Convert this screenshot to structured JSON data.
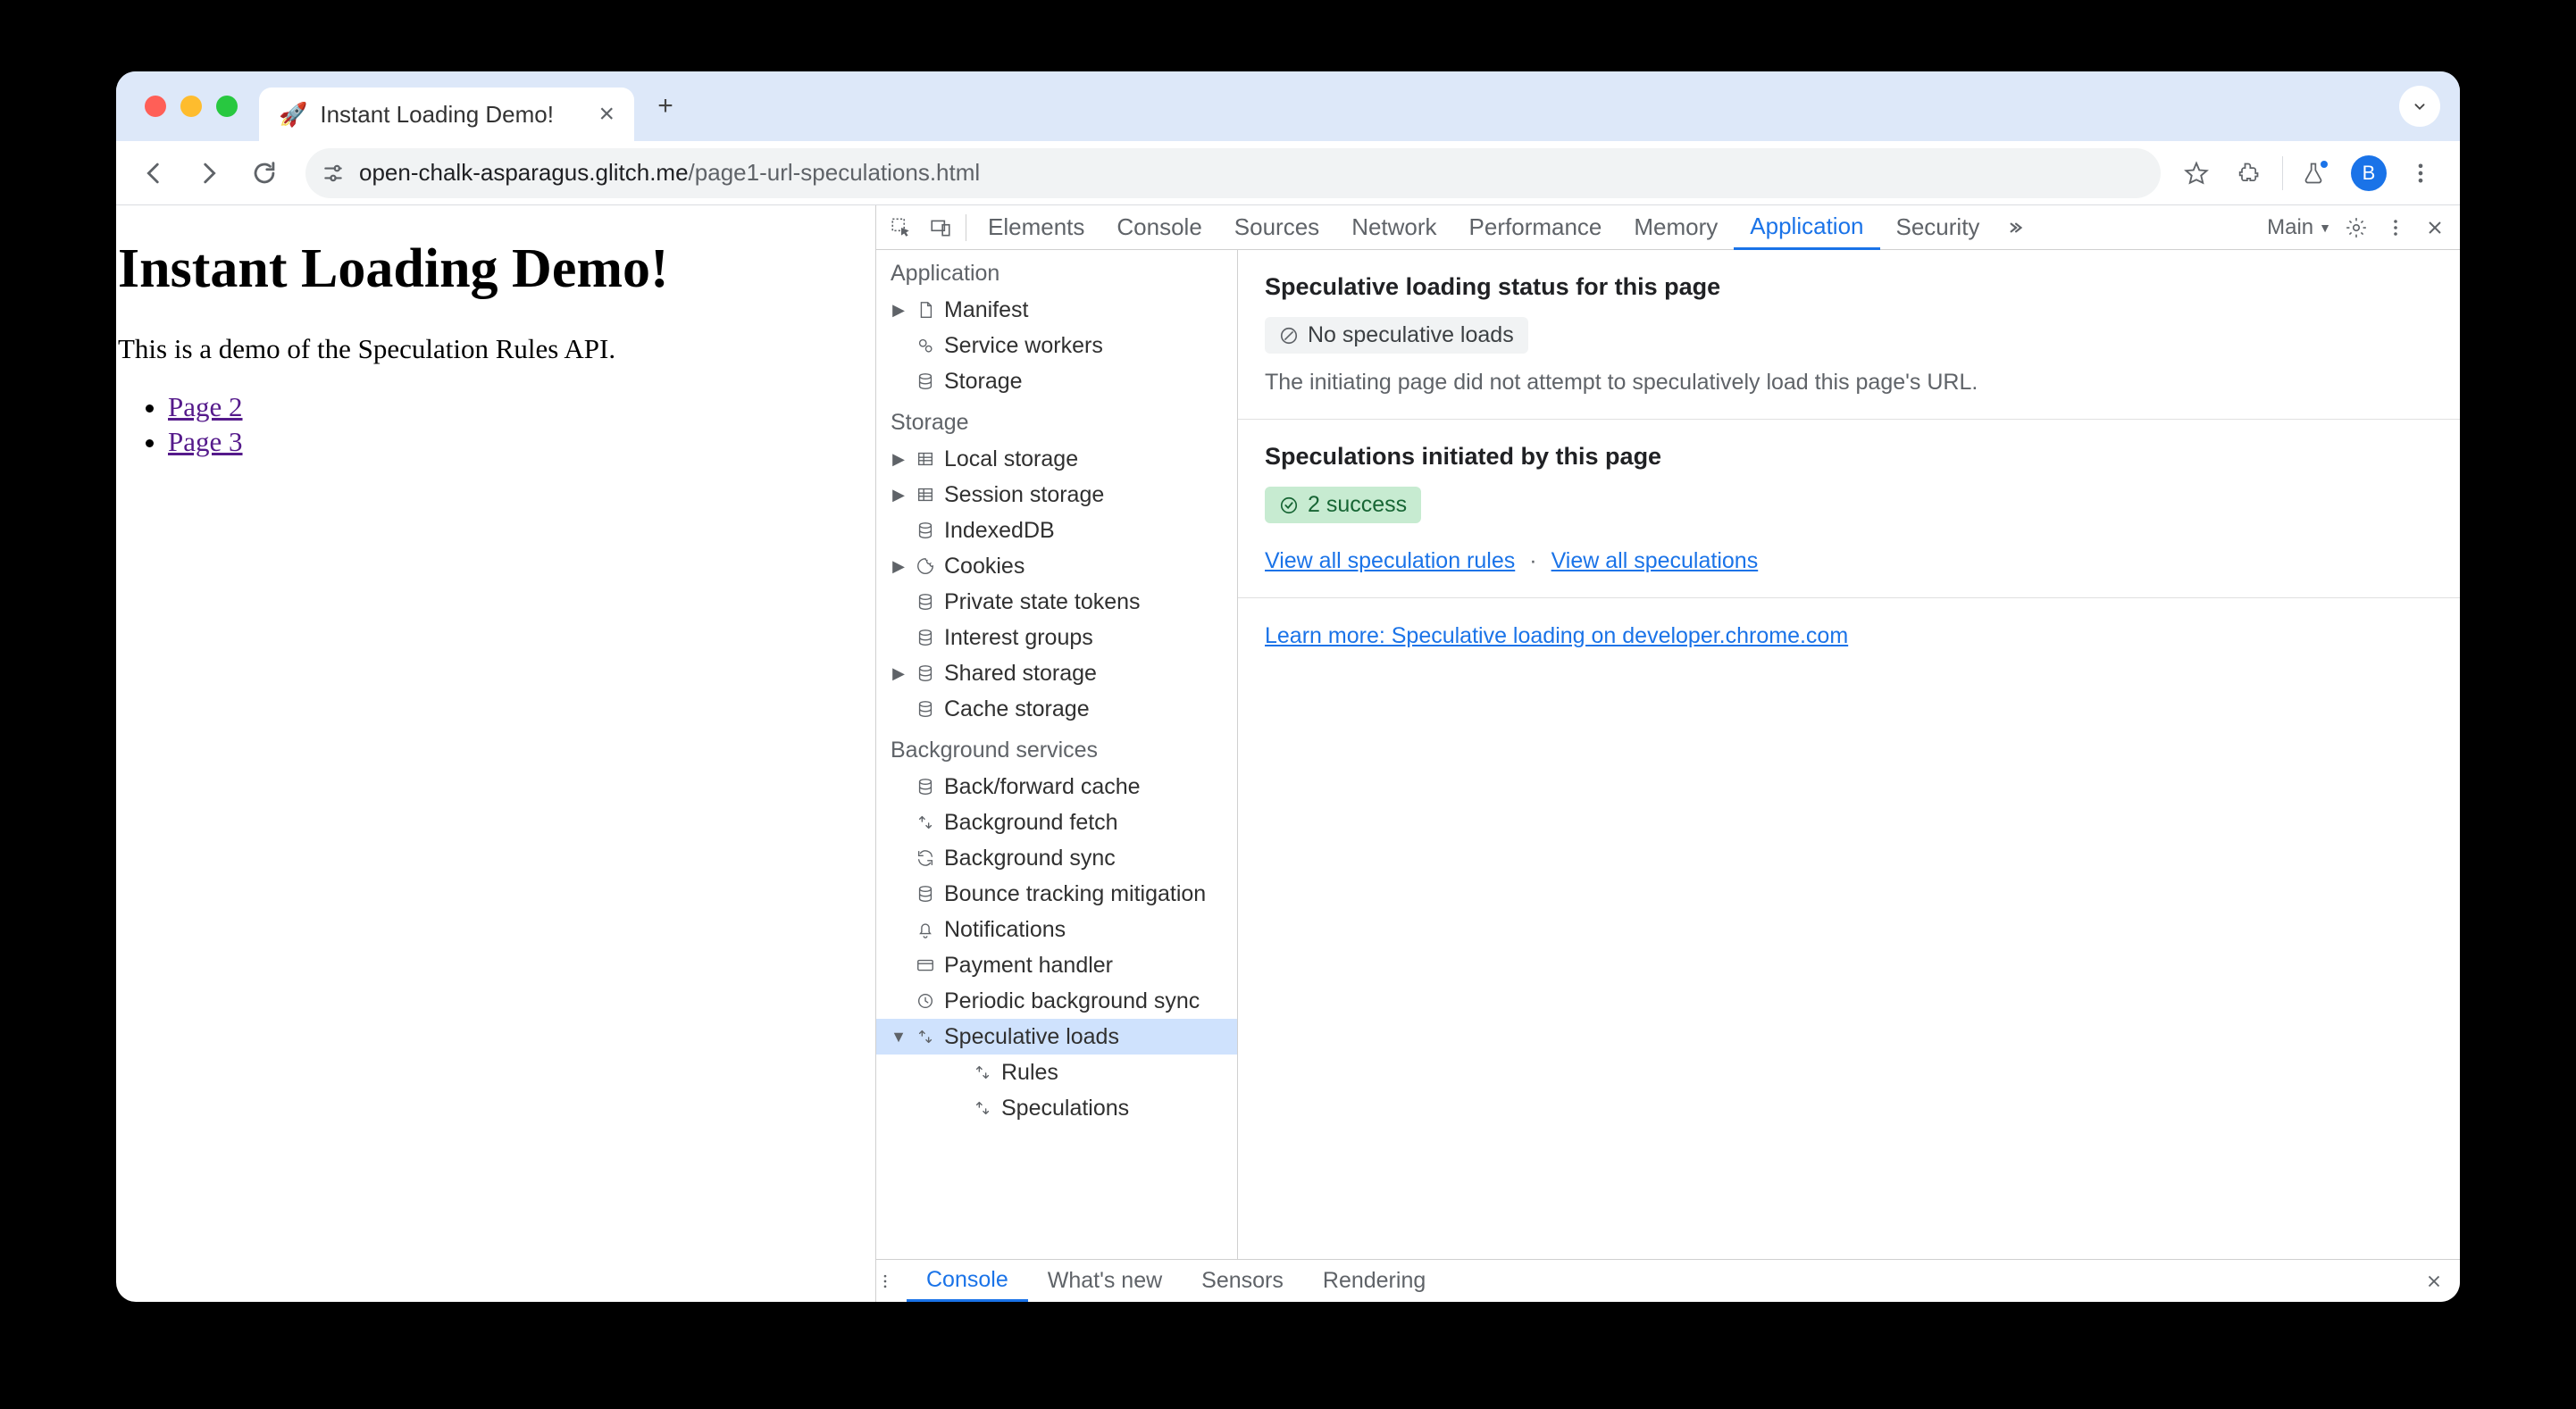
{
  "browser": {
    "tab_title": "Instant Loading Demo!",
    "tab_favicon": "🚀",
    "url_host": "open-chalk-asparagus.glitch.me",
    "url_path": "/page1-url-speculations.html",
    "avatar_letter": "B"
  },
  "page": {
    "heading": "Instant Loading Demo!",
    "intro": "This is a demo of the Speculation Rules API.",
    "links": [
      "Page 2",
      "Page 3"
    ]
  },
  "devtools": {
    "tabs": [
      "Elements",
      "Console",
      "Sources",
      "Network",
      "Performance",
      "Memory",
      "Application",
      "Security"
    ],
    "active_tab": "Application",
    "frame_label": "Main",
    "sidebar": {
      "application": {
        "label": "Application",
        "items": [
          {
            "label": "Manifest",
            "icon": "file",
            "expandable": true
          },
          {
            "label": "Service workers",
            "icon": "gears"
          },
          {
            "label": "Storage",
            "icon": "db"
          }
        ]
      },
      "storage": {
        "label": "Storage",
        "items": [
          {
            "label": "Local storage",
            "icon": "grid",
            "expandable": true
          },
          {
            "label": "Session storage",
            "icon": "grid",
            "expandable": true
          },
          {
            "label": "IndexedDB",
            "icon": "db"
          },
          {
            "label": "Cookies",
            "icon": "cookie",
            "expandable": true
          },
          {
            "label": "Private state tokens",
            "icon": "db"
          },
          {
            "label": "Interest groups",
            "icon": "db"
          },
          {
            "label": "Shared storage",
            "icon": "db",
            "expandable": true
          },
          {
            "label": "Cache storage",
            "icon": "db"
          }
        ]
      },
      "background": {
        "label": "Background services",
        "items": [
          {
            "label": "Back/forward cache",
            "icon": "db"
          },
          {
            "label": "Background fetch",
            "icon": "updown"
          },
          {
            "label": "Background sync",
            "icon": "sync"
          },
          {
            "label": "Bounce tracking mitigation",
            "icon": "db"
          },
          {
            "label": "Notifications",
            "icon": "bell"
          },
          {
            "label": "Payment handler",
            "icon": "card"
          },
          {
            "label": "Periodic background sync",
            "icon": "clock"
          },
          {
            "label": "Speculative loads",
            "icon": "updown",
            "selected": true,
            "expanded": true,
            "children": [
              {
                "label": "Rules",
                "icon": "updown"
              },
              {
                "label": "Speculations",
                "icon": "updown"
              }
            ]
          }
        ]
      }
    },
    "details": {
      "status_heading": "Speculative loading status for this page",
      "status_pill": "No speculative loads",
      "status_desc": "The initiating page did not attempt to speculatively load this page's URL.",
      "init_heading": "Speculations initiated by this page",
      "init_pill": "2 success",
      "link_rules": "View all speculation rules",
      "link_specs": "View all speculations",
      "learn_more": "Learn more: Speculative loading on developer.chrome.com"
    },
    "drawer": {
      "tabs": [
        "Console",
        "What's new",
        "Sensors",
        "Rendering"
      ],
      "active": "Console"
    }
  }
}
